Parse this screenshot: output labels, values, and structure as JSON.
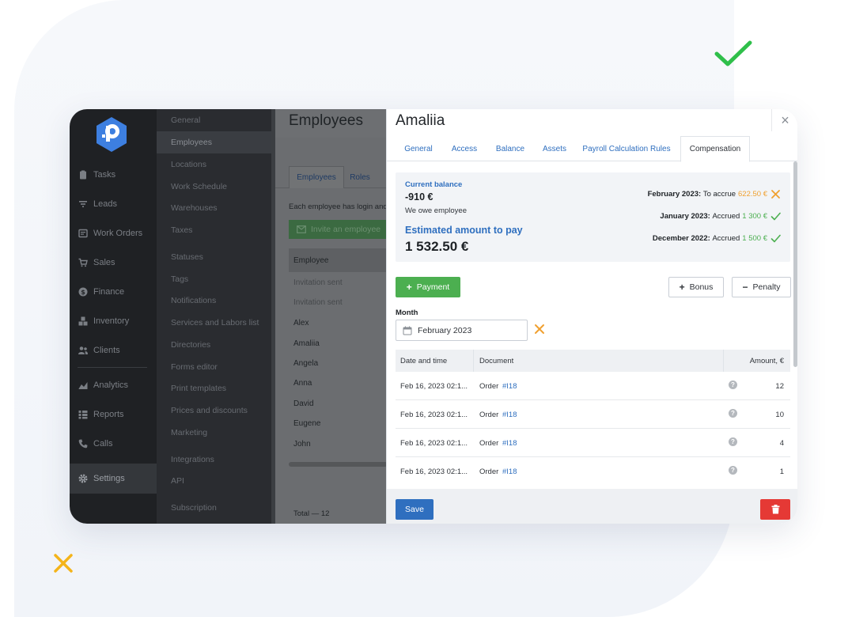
{
  "colors": {
    "accent": "#2f6fbf",
    "success": "#4caf50",
    "warning": "#f0a030",
    "danger": "#e53935",
    "nav_bg": "#1f2124"
  },
  "nav": {
    "items": [
      {
        "label": "Tasks",
        "icon": "clipboard-icon"
      },
      {
        "label": "Leads",
        "icon": "funnel-icon"
      },
      {
        "label": "Work Orders",
        "icon": "work-orders-icon"
      },
      {
        "label": "Sales",
        "icon": "cart-icon"
      },
      {
        "label": "Finance",
        "icon": "dollar-icon"
      },
      {
        "label": "Inventory",
        "icon": "boxes-icon"
      },
      {
        "label": "Clients",
        "icon": "users-icon"
      },
      {
        "label": "Analytics",
        "icon": "chart-icon"
      },
      {
        "label": "Reports",
        "icon": "list-icon"
      },
      {
        "label": "Calls",
        "icon": "phone-icon"
      },
      {
        "label": "Settings",
        "icon": "gear-icon"
      }
    ]
  },
  "settings_menu": {
    "items": [
      "General",
      "Employees",
      "Locations",
      "Work Schedule",
      "Warehouses",
      "Taxes",
      "Statuses",
      "Tags",
      "Notifications",
      "Services and Labors list",
      "Directories",
      "Forms editor",
      "Print templates",
      "Prices and discounts",
      "Marketing",
      "Integrations",
      "API",
      "Subscription"
    ]
  },
  "employees_page": {
    "title": "Employees",
    "tabs": [
      "Employees",
      "Roles"
    ],
    "description": "Each employee has login and",
    "invite_label": "Invite an employee",
    "column_header": "Employee",
    "rows": [
      "Invitation sent",
      "Invitation sent",
      "Alex",
      "Amaliia",
      "Angela",
      "Anna",
      "David",
      "Eugene",
      "John"
    ],
    "total": "Total — 12"
  },
  "panel": {
    "title": "Amaliia",
    "close_label": "×",
    "tabs": [
      "General",
      "Access",
      "Balance",
      "Assets",
      "Payroll Calculation Rules",
      "Compensation"
    ],
    "balance": {
      "current_label": "Current balance",
      "current_value": "-910 €",
      "note": "We owe employee",
      "estimated_label": "Estimated amount to pay",
      "estimated_value": "1 532.50 €"
    },
    "accruals": [
      {
        "period": "February 2023:",
        "text": "To accrue",
        "amount": "622.50 €",
        "status": "pending"
      },
      {
        "period": "January 2023:",
        "text": "Accrued",
        "amount": "1 300 €",
        "status": "done"
      },
      {
        "period": "December 2022:",
        "text": "Accrued",
        "amount": "1 500 €",
        "status": "done"
      }
    ],
    "buttons": {
      "payment": "Payment",
      "bonus": "Bonus",
      "penalty": "Penalty",
      "save": "Save"
    },
    "month": {
      "label": "Month",
      "value": "February 2023"
    },
    "table": {
      "headers": [
        "Date and time",
        "Document",
        "Amount, €"
      ],
      "rows": [
        {
          "date": "Feb 16, 2023 02:1...",
          "doc": "Order",
          "link": "#I18",
          "amount": "12"
        },
        {
          "date": "Feb 16, 2023 02:1...",
          "doc": "Order",
          "link": "#I18",
          "amount": "10"
        },
        {
          "date": "Feb 16, 2023 02:1...",
          "doc": "Order",
          "link": "#I18",
          "amount": "4"
        },
        {
          "date": "Feb 16, 2023 02:1...",
          "doc": "Order",
          "link": "#I18",
          "amount": "1"
        }
      ]
    }
  }
}
